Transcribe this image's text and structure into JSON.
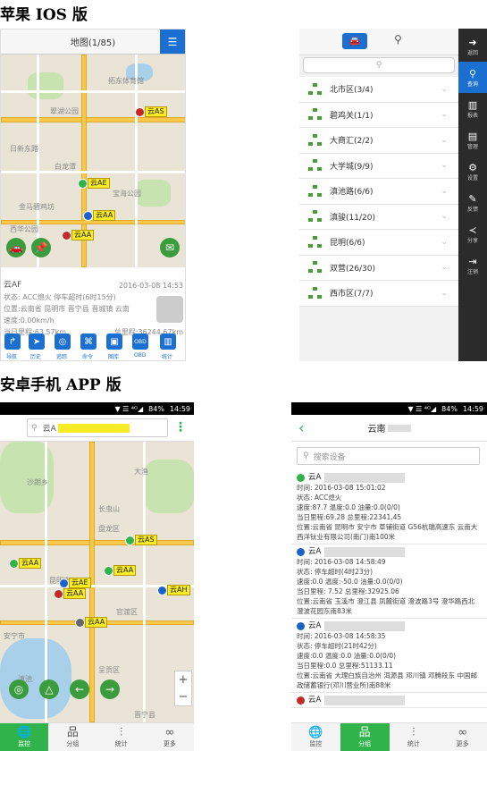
{
  "sections": {
    "ios_title": "苹果 IOS 版",
    "android_title": "安卓手机 APP 版"
  },
  "ios_map": {
    "title": "地图(1/85)",
    "markers": [
      "云AS",
      "云AE",
      "云AA",
      "云AA"
    ],
    "places": [
      "拓东体育馆",
      "翠湖公园",
      "宝海公园",
      "日新东路",
      "白龙潭",
      "金马碧鸡坊",
      "西华公园",
      "宝海"
    ],
    "vehicle_name": "云AF",
    "vehicle_time": "2016-03-08 14:53",
    "status": "状态: ACC熄火 停车超时(6时15分)",
    "location": "位置:云南省 昆明市 晋宁县 晋城镇 云南",
    "speed": "速度:0.00km/h",
    "day_mileage": "当日里程:63.57km",
    "total_mileage": "总里程:36244.67km",
    "toolbar": [
      {
        "label": "导航",
        "icon": "navigation-icon"
      },
      {
        "label": "历史",
        "icon": "history-icon"
      },
      {
        "label": "追踪",
        "icon": "track-icon"
      },
      {
        "label": "命令",
        "icon": "command-icon"
      },
      {
        "label": "图库",
        "icon": "gallery-icon"
      },
      {
        "label": "OBD",
        "icon": "obd-icon"
      },
      {
        "label": "统计",
        "icon": "stats-icon"
      }
    ]
  },
  "ios_groups": {
    "search_placeholder": "",
    "groups": [
      "北市区(3/4)",
      "碧鸡关(1/1)",
      "大商汇(2/2)",
      "大学城(9/9)",
      "滇池路(6/6)",
      "滇骏(11/20)",
      "昆明(6/6)",
      "双营(26/30)",
      "西市区(7/7)"
    ],
    "sidebar": [
      "返回",
      "查询",
      "报表",
      "管理",
      "设置",
      "反馈",
      "分享",
      "注销"
    ]
  },
  "android_map": {
    "status_time": "14:59",
    "battery": "84%",
    "search_text": "云A",
    "markers": [
      "云AS",
      "云AA",
      "云AA",
      "云AH",
      "云AE",
      "云AA",
      "云AA"
    ],
    "places": [
      "沙朗乡",
      "大渔",
      "长虫山",
      "昆明市",
      "盘龙区",
      "官渡区",
      "呈贡区",
      "滇池",
      "晋宁县",
      "安宁市"
    ],
    "tabs": [
      "监控",
      "分组",
      "统计",
      "更多"
    ]
  },
  "android_list": {
    "status_time": "14:59",
    "battery": "84%",
    "title": "云南",
    "search_placeholder": "搜索设备",
    "records": [
      {
        "name": "云A",
        "time": "时间: 2016-03-08 15:01:02",
        "status": "状态: ACC熄火",
        "speed": "速度:87.7    温度:0.0    油量:0.0(0/0)",
        "mileage": "当日里程:69.28    总里程:22341.45",
        "location": "位置:云南省 昆明市 安宁市 草铺街道 G56杭瑞高速东 云南大西洋钛业有限公司(南门)南100米",
        "color": "#2fb34a"
      },
      {
        "name": "云A",
        "time": "时间: 2016-03-08 14:58:49",
        "status": "状态: 停车超时(4时23分)",
        "speed": "速度:0.0    温度:-50.0    油量:0.0(0/0)",
        "mileage": "当日里程: 7.52    总里程:32925.06",
        "location": "位置:云南省 玉溪市 澄江县 凤麓街道 澄波路3号 澄华路西北 澄波花园东南83米",
        "color": "#1a62c9"
      },
      {
        "name": "云A",
        "time": "时间: 2016-03-08 14:58:35",
        "status": "状态: 停车超时(21时42分)",
        "speed": "速度:0.0    温度:0.0    油量:0.0(0/0)",
        "mileage": "当日里程:0.0    总里程:51133.11",
        "location": "位置:云南省 大理白族自治州 洱源县 邓川镇 邓腾段东 中国邮政储蓄银行(邓川营业所)南88米",
        "color": "#1a62c9"
      },
      {
        "name": "云A",
        "time": "",
        "status": "",
        "speed": "",
        "mileage": "",
        "location": "",
        "color": "#c62828"
      }
    ],
    "tabs": [
      "监控",
      "分组",
      "统计",
      "更多"
    ]
  }
}
